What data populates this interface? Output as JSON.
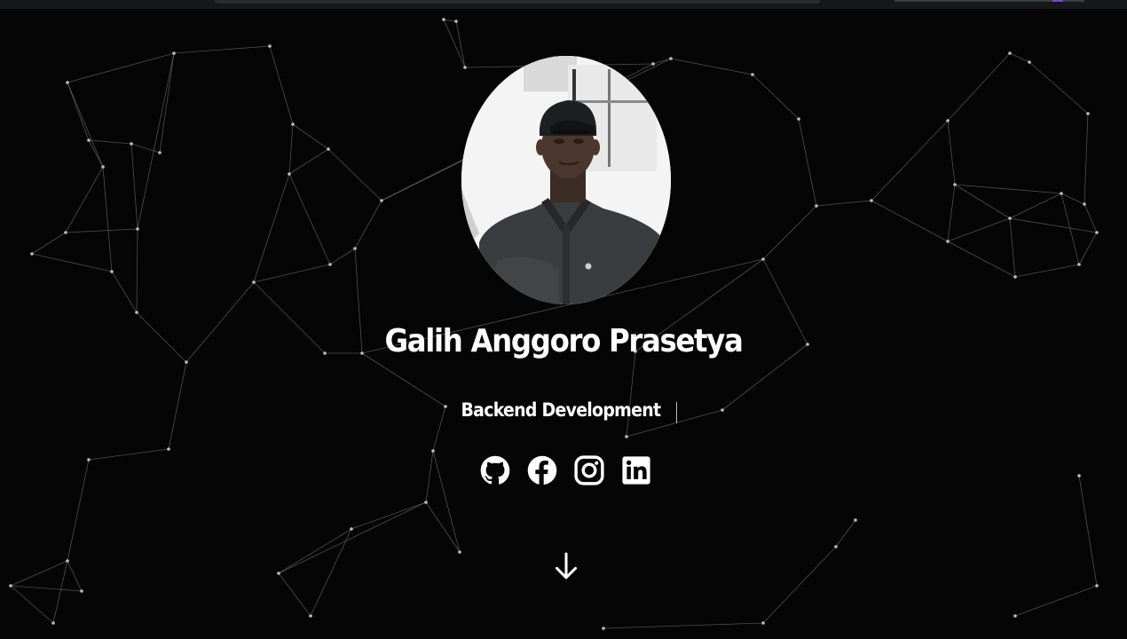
{
  "browser": {
    "accent_color": "#7b3fe4"
  },
  "hero": {
    "name": "Galih Anggoro Prasetya",
    "role": "Backend Development",
    "background_color": "#050505",
    "network_line_color": "#8a8a8a"
  },
  "socials": [
    {
      "icon": "github-icon"
    },
    {
      "icon": "facebook-icon"
    },
    {
      "icon": "instagram-icon"
    },
    {
      "icon": "linkedin-icon"
    }
  ],
  "scroll": {
    "icon": "arrow-down-icon"
  }
}
